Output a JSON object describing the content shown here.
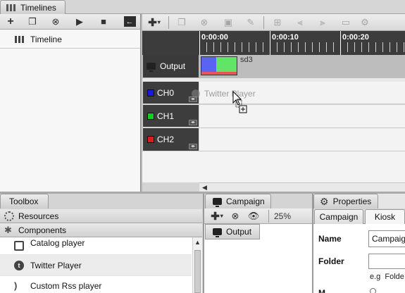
{
  "timelines_tab": {
    "label": "Timelines"
  },
  "left_toolbar": {
    "icons": [
      "plus-icon",
      "copy-icon",
      "remove-icon",
      "play-icon",
      "stop-icon",
      "collapse-arrow-icon"
    ]
  },
  "timeline_list": {
    "items": [
      {
        "label": "Timeline"
      }
    ]
  },
  "editor_toolbar": {
    "icons": [
      "add-dropdown-icon",
      "copy-icon",
      "remove-icon",
      "delete-icon",
      "edit-icon",
      "split-add-icon",
      "align-left-icon",
      "align-right-icon",
      "expand-icon",
      "settings-icon"
    ]
  },
  "ruler": {
    "ticks": [
      "0:00:00",
      "0:00:10",
      "0:00:20"
    ]
  },
  "output_track": {
    "label": "Output",
    "block_label": "sd3",
    "colors": {
      "block1": "#5b63f2",
      "block2": "#62e567",
      "underline": "#e8545a"
    }
  },
  "channels": [
    {
      "label": "CH0",
      "color": "#1a1adf"
    },
    {
      "label": "CH1",
      "color": "#19c92a"
    },
    {
      "label": "CH2",
      "color": "#de1a1a"
    }
  ],
  "drag_ghost": {
    "label": "Twitter Player"
  },
  "toolbox": {
    "tab_label": "Toolbox",
    "sections": [
      {
        "label": "Resources"
      },
      {
        "label": "Components"
      }
    ],
    "items": [
      {
        "label": "Catalog player"
      },
      {
        "label": "Twitter Player"
      },
      {
        "label": "Custom Rss player"
      }
    ]
  },
  "campaign_panel": {
    "tab_label": "Campaign",
    "zoom": "25%",
    "output_label": "Output"
  },
  "properties_panel": {
    "tab_label": "Properties",
    "subtabs": [
      "Campaign",
      "Kiosk"
    ],
    "name_label": "Name",
    "name_value": "Campaig",
    "folder_label": "Folder",
    "folder_hint": "e.g  Folde",
    "cut_label": "M"
  }
}
